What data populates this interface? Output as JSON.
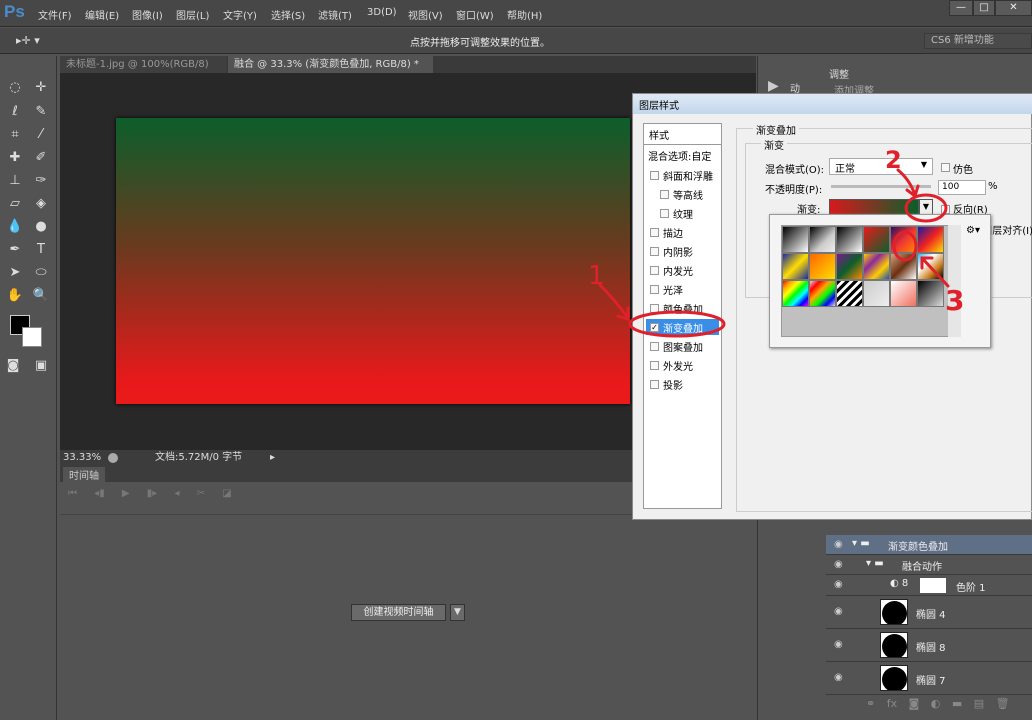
{
  "app": {
    "logo": "Ps",
    "menus": [
      "文件(F)",
      "编辑(E)",
      "图像(I)",
      "图层(L)",
      "文字(Y)",
      "选择(S)",
      "滤镜(T)",
      "3D(D)",
      "视图(V)",
      "窗口(W)",
      "帮助(H)"
    ],
    "window_buttons": [
      "—",
      "□",
      "✕"
    ]
  },
  "options": {
    "tool": "▸✛ ▾",
    "hint": "点按并拖移可调整效果的位置。",
    "workspace": "CS6 新增功能"
  },
  "tabs": [
    {
      "label": "未标题-1.jpg @ 100%(RGB/8)",
      "close": "×"
    },
    {
      "label": "融合 @ 33.3% (渐变颜色叠加, RGB/8) *",
      "close": "×"
    }
  ],
  "status": {
    "zoom": "33.33%",
    "doc": "文档:5.72M/0 字节"
  },
  "timeline": {
    "tab": "时间轴",
    "create_button": "创建视频时间轴"
  },
  "right": {
    "mini_label": "动",
    "adjust_tab": "调整",
    "adjust_sub": "添加调整"
  },
  "dialog": {
    "title": "图层样式",
    "styles_header": "样式",
    "blend_options": "混合选项:自定",
    "styles": [
      {
        "label": "斜面和浮雕",
        "checked": false,
        "indent": false
      },
      {
        "label": "等高线",
        "checked": false,
        "indent": true
      },
      {
        "label": "纹理",
        "checked": false,
        "indent": true
      },
      {
        "label": "描边",
        "checked": false,
        "indent": false
      },
      {
        "label": "内阴影",
        "checked": false,
        "indent": false
      },
      {
        "label": "内发光",
        "checked": false,
        "indent": false
      },
      {
        "label": "光泽",
        "checked": false,
        "indent": false
      },
      {
        "label": "颜色叠加",
        "checked": false,
        "indent": false
      },
      {
        "label": "渐变叠加",
        "checked": true,
        "indent": false,
        "selected": true
      },
      {
        "label": "图案叠加",
        "checked": false,
        "indent": false
      },
      {
        "label": "外发光",
        "checked": false,
        "indent": false
      },
      {
        "label": "投影",
        "checked": false,
        "indent": false
      }
    ],
    "section": "渐变叠加",
    "group": "渐变",
    "blend_mode_label": "混合模式(O):",
    "blend_mode": "正常",
    "dither": "仿色",
    "opacity_label": "不透明度(P):",
    "opacity": "100",
    "percent": "%",
    "gradient_label": "渐变:",
    "reverse": "反向(R)",
    "align": "与图层对齐(I)",
    "gear": "⚙▾"
  },
  "annotations": [
    "1",
    "2",
    "3"
  ],
  "layers": [
    {
      "name": "渐变颜色叠加",
      "type": "group",
      "selected": true
    },
    {
      "name": "融合动作",
      "type": "group"
    },
    {
      "name": "色阶 1",
      "type": "adjustment"
    },
    {
      "name": "椭圆 4",
      "type": "shape"
    },
    {
      "name": "椭圆 8",
      "type": "shape"
    },
    {
      "name": "椭圆 7",
      "type": "shape"
    }
  ],
  "colors": {
    "accent": "#3a8ee6",
    "annotation": "#e0202a",
    "gradient_top": "#0c5e2b",
    "gradient_bottom": "#e8191b"
  }
}
